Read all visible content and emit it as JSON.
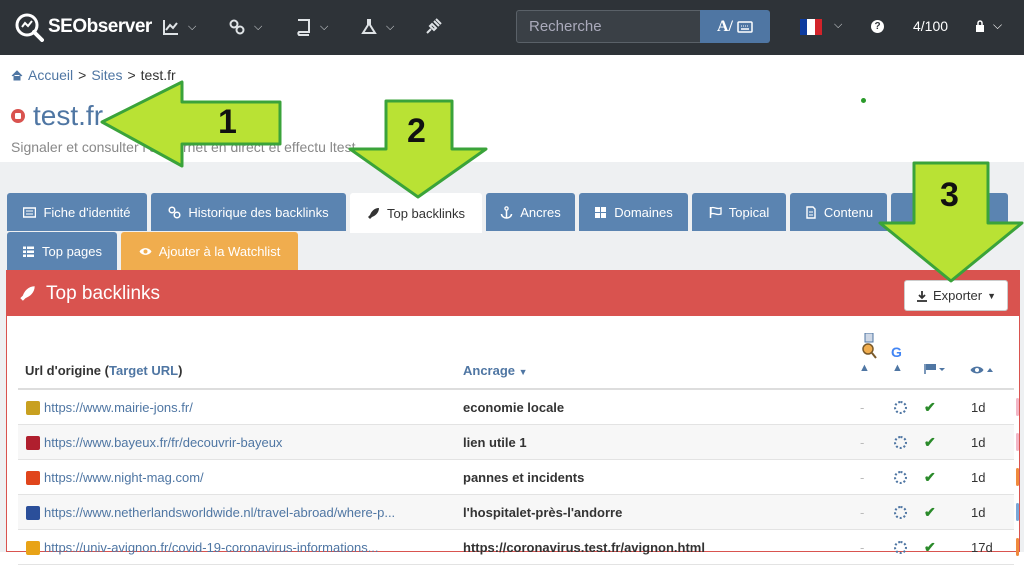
{
  "app": {
    "name": "SEObserver"
  },
  "header": {
    "search_placeholder": "Recherche",
    "search_button_label": "A/",
    "quota": "4/100"
  },
  "breadcrumb": {
    "home": "Accueil",
    "sites": "Sites",
    "current": "test.fr",
    "sep": ">"
  },
  "page": {
    "title": "test.fr",
    "subtitle": "Signaler et consulter l   s internet en direct et effectu   ltest"
  },
  "tabs": [
    {
      "label": "Fiche d'identité",
      "icon": "id-card-icon"
    },
    {
      "label": "Historique des backlinks",
      "icon": "link-icon"
    },
    {
      "label": "Top backlinks",
      "icon": "rocket-icon",
      "active": true
    },
    {
      "label": "Ancres",
      "icon": "anchor-icon"
    },
    {
      "label": "Domaines",
      "icon": "grid-icon"
    },
    {
      "label": "Topical",
      "icon": "flag-icon"
    },
    {
      "label": "Contenu",
      "icon": "document-icon"
    },
    {
      "label": "Top pages",
      "icon": "list-icon"
    },
    {
      "label": "Ajouter à la Watchlist",
      "icon": "eye-icon"
    }
  ],
  "panel": {
    "title": "Top backlinks",
    "export_label": "Exporter"
  },
  "table": {
    "col_source": "Url d'origine (",
    "col_source_link": "Target URL",
    "col_source_end": ")",
    "col_anchor": "Ancrage",
    "rows": [
      {
        "url": "https://www.mairie-jons.fr/",
        "anchor": "economie locale",
        "dash": "-",
        "age": "1d",
        "fav_color": "#c8a020",
        "mark": "#f3b6c6"
      },
      {
        "url": "https://www.bayeux.fr/fr/decouvrir-bayeux",
        "anchor": "lien utile 1",
        "dash": "-",
        "age": "1d",
        "fav_color": "#b01f2e",
        "mark": "#f3b6c6"
      },
      {
        "url": "https://www.night-mag.com/",
        "anchor": "pannes et incidents",
        "dash": "-",
        "age": "1d",
        "fav_color": "#e0451c",
        "mark": "#f08a3c"
      },
      {
        "url": "https://www.netherlandsworldwide.nl/travel-abroad/where-p...",
        "anchor": "l'hospitalet-près-l'andorre",
        "dash": "-",
        "age": "1d",
        "fav_color": "#2b4f9a",
        "mark": "#7aa7d8"
      },
      {
        "url": "https://univ-avignon.fr/covid-19-coronavirus-informations...",
        "anchor": "https://coronavirus.test.fr/avignon.html",
        "dash": "-",
        "age": "17d",
        "fav_color": "#e8a317",
        "mark": "#f08a3c"
      }
    ]
  },
  "annotations": [
    {
      "label": "1"
    },
    {
      "label": "2"
    },
    {
      "label": "3"
    }
  ],
  "colors": {
    "topbar": "#2e3338",
    "accent": "#4f76a3",
    "tab": "#5b84b1",
    "panel_red": "#d9534f",
    "watchlist": "#f0ad4e",
    "annotation_fill": "#b9e234",
    "annotation_stroke": "#3aa33a"
  }
}
